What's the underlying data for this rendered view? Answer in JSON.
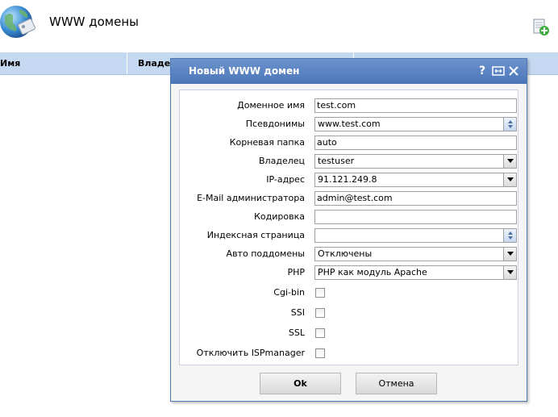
{
  "page": {
    "title": "WWW домены",
    "icons": {
      "app": "globe-icon",
      "add": "add-domain-icon"
    }
  },
  "table": {
    "columns": [
      "Имя",
      "Владел"
    ]
  },
  "dialog": {
    "title": "Новый WWW домен",
    "titlebar_icons": [
      "help-icon",
      "resize-icon",
      "close-icon"
    ],
    "help_glyph": "?",
    "fields": {
      "domain_name": {
        "label": "Доменное имя",
        "value": "test.com"
      },
      "aliases": {
        "label": "Псевдонимы",
        "value": "www.test.com"
      },
      "root_folder": {
        "label": "Корневая папка",
        "value": "auto"
      },
      "owner": {
        "label": "Владелец",
        "value": "testuser"
      },
      "ip_address": {
        "label": "IP-адрес",
        "value": "91.121.249.8"
      },
      "admin_email": {
        "label": "E-Mail администратора",
        "value": "admin@test.com"
      },
      "encoding": {
        "label": "Кодировка",
        "value": ""
      },
      "index_page": {
        "label": "Индексная страница",
        "value": ""
      },
      "auto_subdomains": {
        "label": "Авто поддомены",
        "value": "Отключены"
      },
      "php": {
        "label": "PHP",
        "value": "PHP как модуль Apache"
      },
      "cgi_bin": {
        "label": "Cgi-bin",
        "checked": false
      },
      "ssi": {
        "label": "SSI",
        "checked": false
      },
      "ssl": {
        "label": "SSL",
        "checked": false
      },
      "disable_ispmanager": {
        "label": "Отключить ISPmanager",
        "checked": false
      }
    },
    "buttons": {
      "ok": "Ok",
      "cancel": "Отмена"
    }
  },
  "colors": {
    "titlebar": "#4a76b9",
    "table_header": "#c5d8f1",
    "dialog_bg": "#f5f5f5"
  }
}
